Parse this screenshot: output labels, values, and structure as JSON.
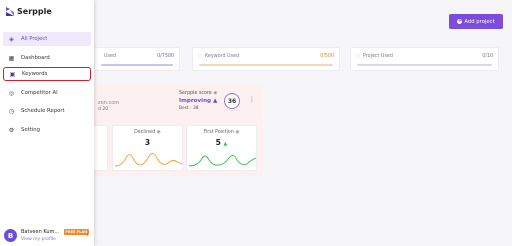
{
  "app": {
    "name": "Serpple"
  },
  "header": {
    "add_project_label": "Add project"
  },
  "stats": [
    {
      "label": "Used",
      "value": "0/7500"
    },
    {
      "label": "Keyword Used",
      "value": "0/500"
    },
    {
      "label": "Project Used",
      "value": "0/10"
    }
  ],
  "project_card": {
    "domain": "zon.com",
    "count": "d 20",
    "score_title": "Serpple score",
    "score_status": "Improving",
    "best": "Best : 38",
    "score": "36",
    "mini_cards": [
      {
        "title": "Declined",
        "value": "3",
        "color": "#f0a040"
      },
      {
        "title": "First Position",
        "value": "5",
        "color": "#35c24a"
      }
    ]
  },
  "sidebar": {
    "items": [
      {
        "label": "All Project",
        "icon": "layers-icon"
      },
      {
        "label": "Dashboard",
        "icon": "grid-icon"
      },
      {
        "label": "Keywords",
        "icon": "keyword-icon"
      },
      {
        "label": "Competitor AI",
        "icon": "bulb-icon"
      },
      {
        "label": "Schedule Report",
        "icon": "clock-icon"
      },
      {
        "label": "Setting",
        "icon": "gear-icon"
      }
    ]
  },
  "user": {
    "name": "Batveen Kum...",
    "plan": "FREE PLAN",
    "link": "View my profile",
    "initial": "B"
  },
  "colors": {
    "accent": "#7d4cdb",
    "highlight": "#d81e2c"
  }
}
